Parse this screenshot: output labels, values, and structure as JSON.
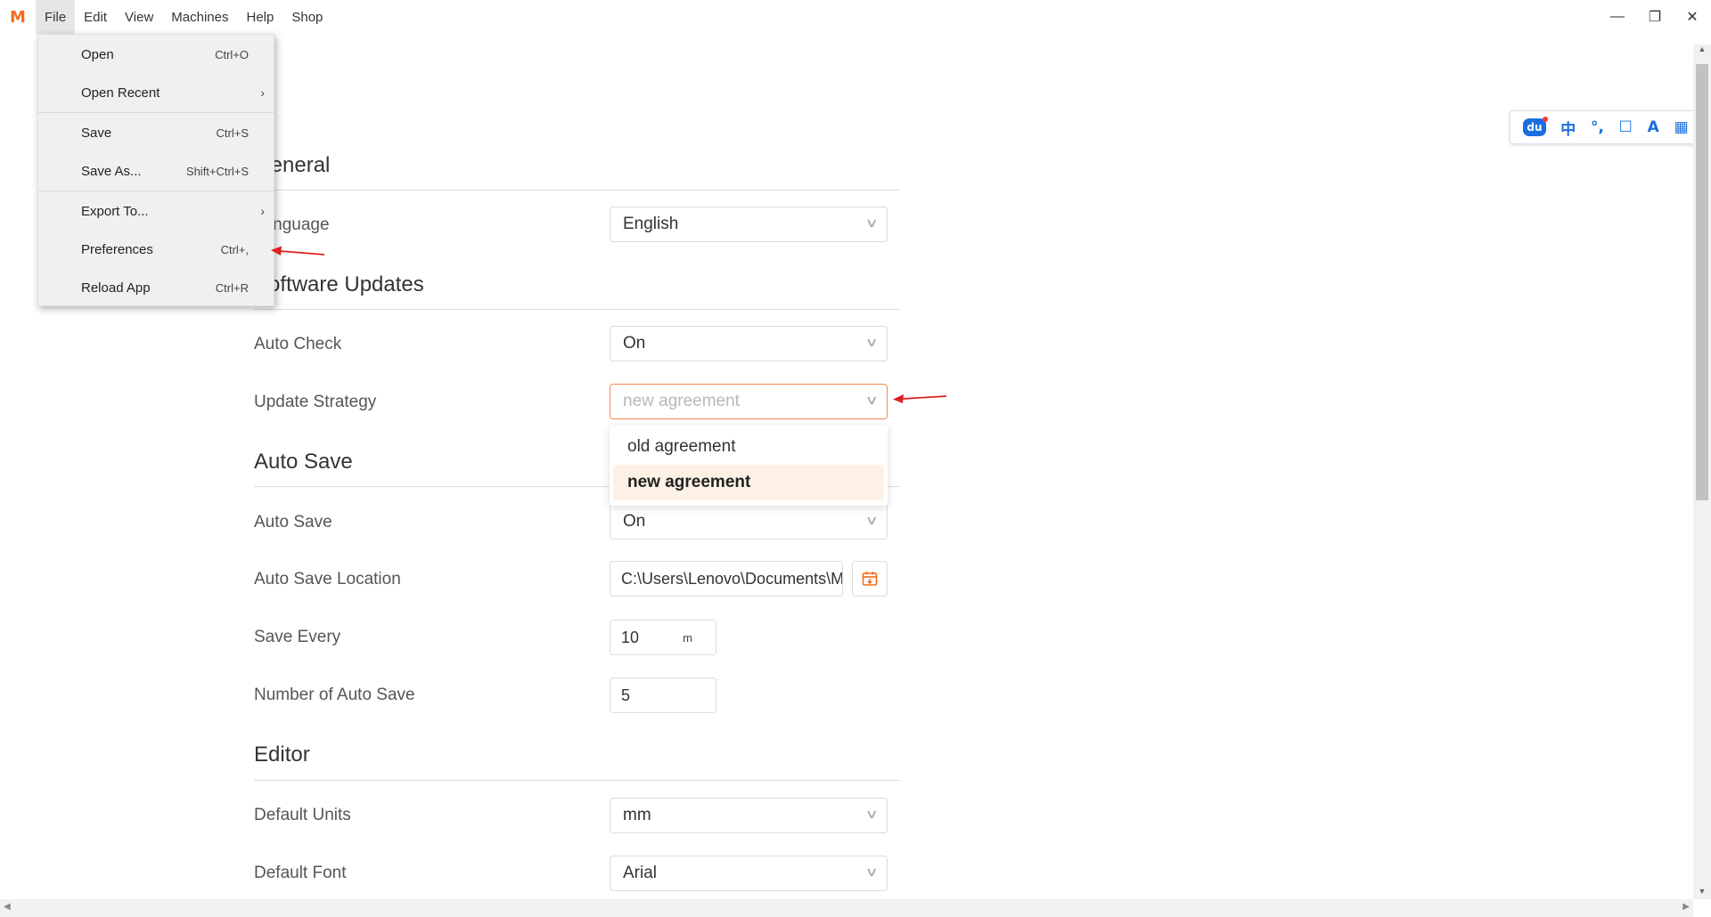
{
  "menubar": {
    "logo": "M",
    "items": [
      "File",
      "Edit",
      "View",
      "Machines",
      "Help",
      "Shop"
    ]
  },
  "window_controls": {
    "minimize": "—",
    "restore": "❐",
    "close": "✕"
  },
  "ime_toolbar": {
    "items": [
      "du",
      "中",
      "°,",
      "☐",
      "A",
      "▦"
    ]
  },
  "file_menu": {
    "items": [
      {
        "label": "Open",
        "shortcut": "Ctrl+O"
      },
      {
        "label": "Open Recent",
        "submenu": "›"
      },
      {
        "label": "Save",
        "shortcut": "Ctrl+S"
      },
      {
        "label": "Save As...",
        "shortcut": "Shift+Ctrl+S"
      },
      {
        "label": "Export To...",
        "submenu": "›"
      },
      {
        "label": "Preferences",
        "shortcut": "Ctrl+,"
      },
      {
        "label": "Reload App",
        "shortcut": "Ctrl+R"
      }
    ]
  },
  "settings": {
    "general": {
      "title": "General",
      "language_label": "Language",
      "language_value": "English"
    },
    "software_updates": {
      "title": "Software Updates",
      "auto_check_label": "Auto Check",
      "auto_check_value": "On",
      "update_strategy_label": "Update Strategy",
      "update_strategy_value": "new agreement",
      "update_strategy_options": [
        "old agreement",
        "new agreement"
      ]
    },
    "auto_save": {
      "title": "Auto Save",
      "auto_save_label": "Auto Save",
      "auto_save_value": "On",
      "location_label": "Auto Save Location",
      "location_value": "C:\\Users\\Lenovo\\Documents\\M-",
      "save_every_label": "Save Every",
      "save_every_value": "10",
      "save_every_unit": "m",
      "count_label": "Number of Auto Save",
      "count_value": "5"
    },
    "editor": {
      "title": "Editor",
      "units_label": "Default Units",
      "units_value": "mm",
      "font_label": "Default Font",
      "font_value": "Arial"
    }
  },
  "colors": {
    "accent": "#f08a4b",
    "annotation_arrow": "#e02020"
  }
}
